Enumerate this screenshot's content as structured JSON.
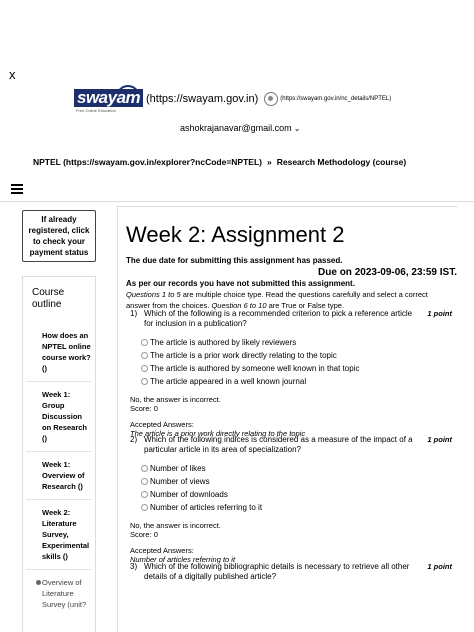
{
  "close_label": "x",
  "header": {
    "swayam_logo_text": "swayam",
    "swayam_logo_tagline": "Free Online Education",
    "swayam_link": "(https://swayam.gov.in)",
    "nptel_link": "(https://swayam.gov.in/nc_details/NPTEL)",
    "user_email": "ashokrajanavar@gmail.com",
    "user_chevron": "⌄"
  },
  "breadcrumb": {
    "parent": "NPTEL (https://swayam.gov.in/explorer?ncCode=NPTEL)",
    "separator": "»",
    "current": "Research Methodology (course)"
  },
  "sidebar": {
    "register_box": "If already registered, click to check your payment status",
    "outline_title": "Course outline",
    "items": [
      "How does an NPTEL online course work? ()",
      "Week 1: Group Discussion on Research ()",
      "Week 1: Overview of Research ()",
      "Week 2: Literature Survey, Experimental skills ()"
    ],
    "subitems": [
      "Overview of Literature Survey (unit?"
    ]
  },
  "assignment": {
    "title": "Week 2: Assignment 2",
    "due_passed": "The due date for submitting this assignment has passed.",
    "due_on": "Due on 2023-09-06, 23:59 IST.",
    "not_submitted": "As per our records you have not submitted this assignment.",
    "instructions": "Questions 1 to 5 are multiple choice type. Read the questions carefully and select a correct answer from the choices. Question 6 to 10 are True or False type."
  },
  "questions": [
    {
      "number": "1)",
      "text": "Which of the following is a recommended criterion to pick a reference article for inclusion in a publication?",
      "points": "1 point",
      "options": [
        "The article is authored by likely reviewers",
        "The article is a prior work directly relating to the topic",
        "The article is authored by someone well known in that topic",
        "The article appeared in a well known journal"
      ],
      "result": "No, the answer is incorrect.",
      "score": "Score: 0",
      "accepted_label": "Accepted Answers:",
      "accepted_answer": "The article is a prior work directly relating to the topic"
    },
    {
      "number": "2)",
      "text": "Which of the following indices is considered as a measure of the impact of a particular article in its area of specialization?",
      "points": "1 point",
      "options": [
        "Number of likes",
        "Number of views",
        "Number of downloads",
        "Number of articles referring to it"
      ],
      "result": "No, the answer is incorrect.",
      "score": "Score: 0",
      "accepted_label": "Accepted Answers:",
      "accepted_answer": "Number of articles referring to it"
    },
    {
      "number": "3)",
      "text": "Which of the following bibliographic details is necessary to retrieve all other details of a digitally published article?",
      "points": "1 point"
    }
  ]
}
